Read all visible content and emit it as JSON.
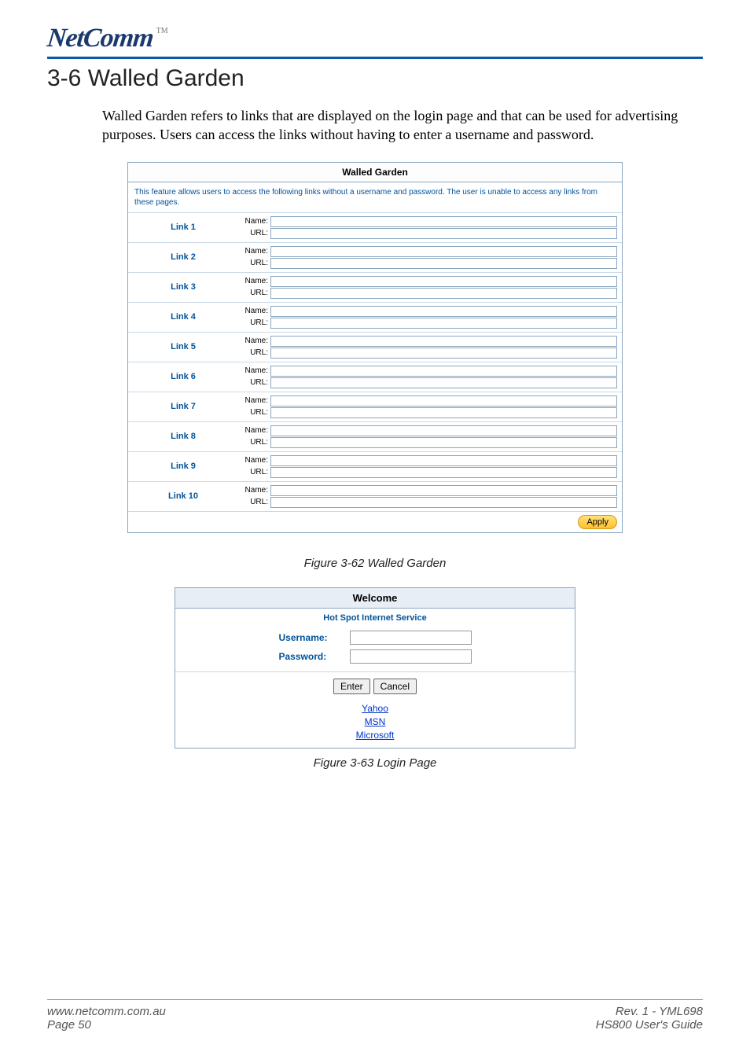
{
  "brand": {
    "name": "NetComm",
    "tm": "TM"
  },
  "heading": "3-6   Walled Garden",
  "intro": "Walled Garden refers to links that are displayed on the login page and that can be used for advertising purposes.  Users can access the links without having to enter a username and password.",
  "cfg": {
    "title": "Walled Garden",
    "desc": "This feature allows users to access the following links without a username and password. The user is unable to access any links from these pages.",
    "name_label": "Name:",
    "url_label": "URL:",
    "links": [
      {
        "label": "Link 1"
      },
      {
        "label": "Link 2"
      },
      {
        "label": "Link 3"
      },
      {
        "label": "Link 4"
      },
      {
        "label": "Link 5"
      },
      {
        "label": "Link 6"
      },
      {
        "label": "Link 7"
      },
      {
        "label": "Link 8"
      },
      {
        "label": "Link 9"
      },
      {
        "label": "Link 10"
      }
    ],
    "apply": "Apply"
  },
  "caption1": "Figure 3-62 Walled Garden",
  "login": {
    "welcome": "Welcome",
    "subtitle": "Hot Spot Internet Service",
    "username_label": "Username:",
    "password_label": "Password:",
    "enter": "Enter",
    "cancel": "Cancel",
    "links": [
      "Yahoo",
      "MSN",
      "Microsoft"
    ]
  },
  "caption2": "Figure 3-63 Login Page",
  "footer": {
    "url": "www.netcomm.com.au",
    "page": "Page 50",
    "rev": "Rev. 1 - YML698",
    "guide": "HS800 User's Guide"
  }
}
